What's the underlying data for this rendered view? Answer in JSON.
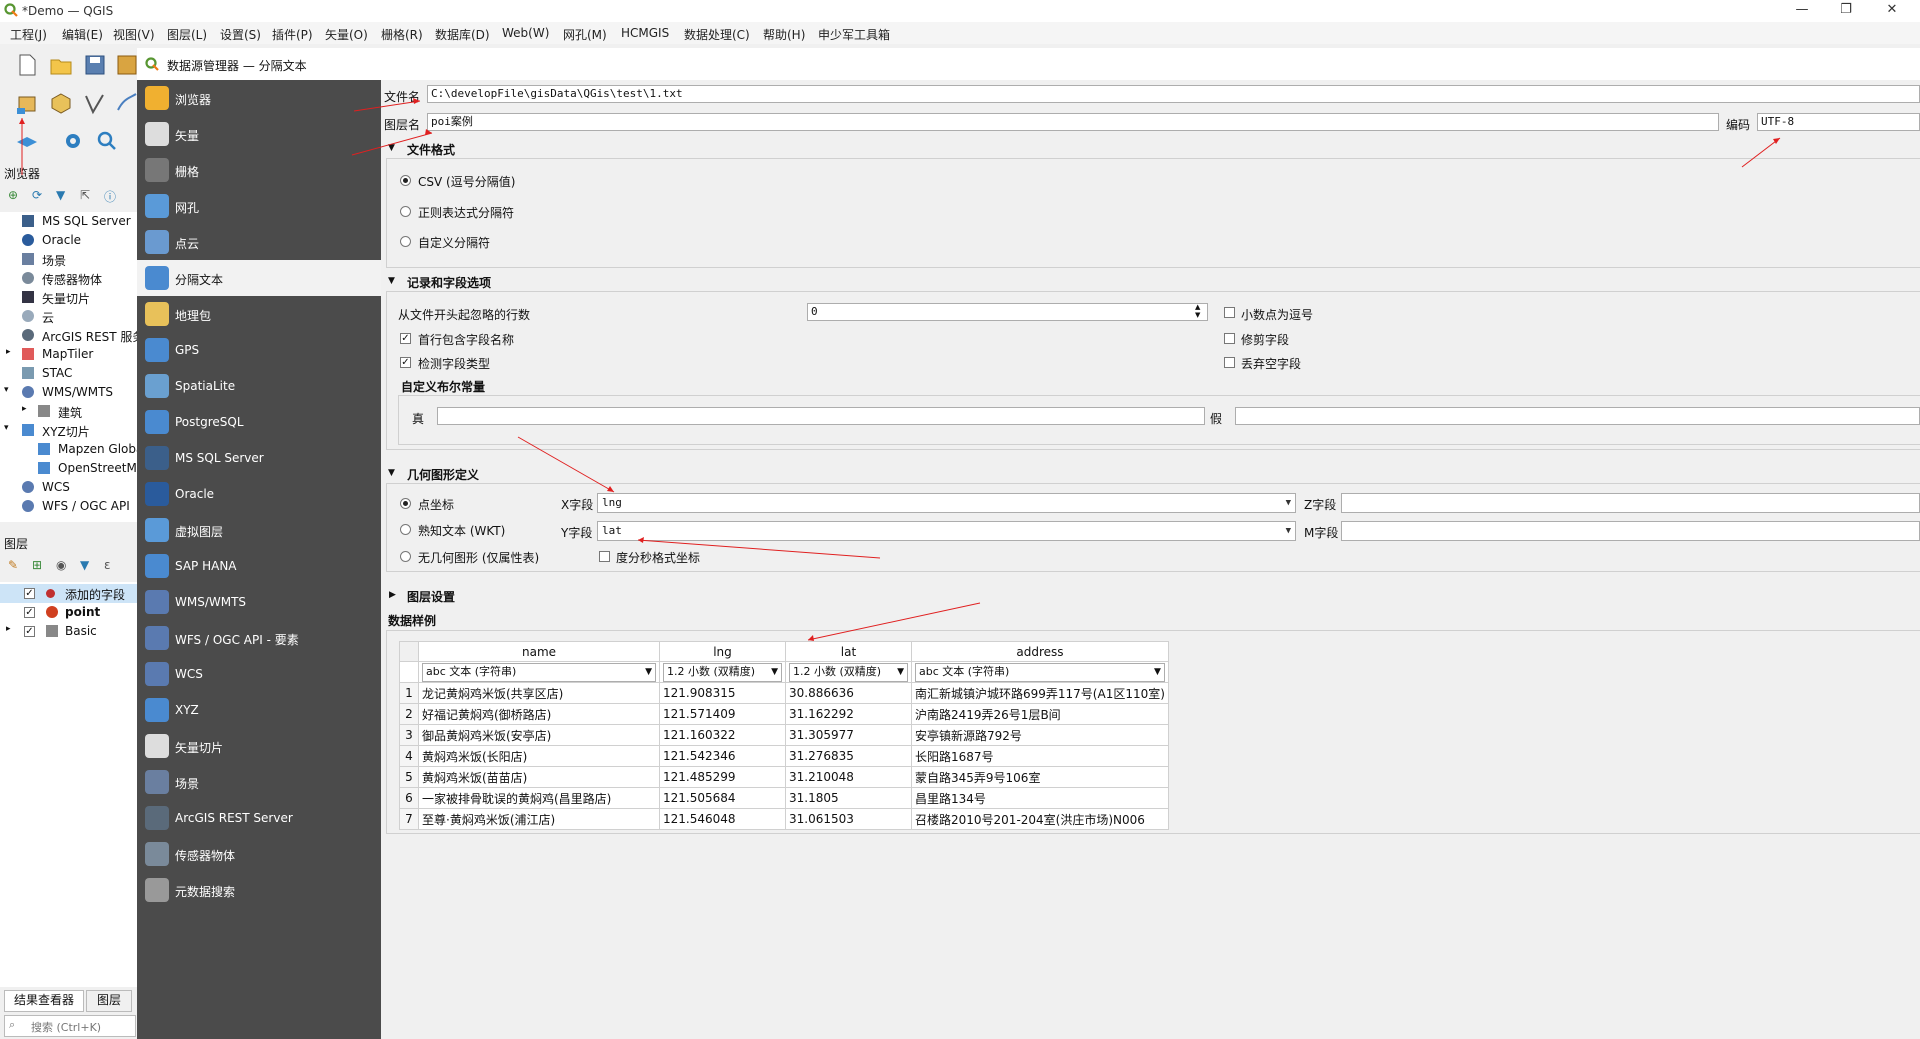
{
  "window": {
    "title": "*Demo — QGIS"
  },
  "menu": [
    "工程(J)",
    "编辑(E)",
    "视图(V)",
    "图层(L)",
    "设置(S)",
    "插件(P)",
    "矢量(O)",
    "栅格(R)",
    "数据库(D)",
    "Web(W)",
    "网孔(M)",
    "HCMGIS",
    "数据处理(C)",
    "帮助(H)",
    "申少军工具箱"
  ],
  "browser": {
    "title": "浏览器",
    "items": [
      "MS SQL Server",
      "Oracle",
      "场景",
      "传感器物体",
      "矢量切片",
      "云",
      "ArcGIS REST 服务",
      "MapTiler",
      "STAC",
      "WMS/WMTS",
      "建筑",
      "XYZ切片",
      "Mapzen Global",
      "OpenStreetMap",
      "WCS",
      "WFS / OGC API"
    ]
  },
  "layers": {
    "title": "图层",
    "items": [
      "添加的字段",
      "point",
      "Basic"
    ]
  },
  "bottom_tabs": [
    "结果查看器",
    "图层"
  ],
  "search": {
    "placeholder": "搜索 (Ctrl+K)"
  },
  "dsm": {
    "title": "数据源管理器 — 分隔文本",
    "side": [
      "浏览器",
      "矢量",
      "栅格",
      "网孔",
      "点云",
      "分隔文本",
      "地理包",
      "GPS",
      "SpatiaLite",
      "PostgreSQL",
      "MS SQL Server",
      "Oracle",
      "虚拟图层",
      "SAP HANA",
      "WMS/WMTS",
      "WFS / OGC API - 要素",
      "WCS",
      "XYZ",
      "矢量切片",
      "场景",
      "ArcGIS REST Server",
      "传感器物体",
      "元数据搜索"
    ]
  },
  "form": {
    "file_label": "文件名",
    "file_value": "C:\\developFile\\gisData\\QGis\\test\\1.txt",
    "layer_label": "图层名",
    "layer_value": "poi案例",
    "encoding_label": "编码",
    "encoding_value": "UTF-8",
    "fileformat_title": "文件格式",
    "fmt_csv": "CSV (逗号分隔值)",
    "fmt_regex": "正则表达式分隔符",
    "fmt_custom": "自定义分隔符",
    "records_title": "记录和字段选项",
    "skip_label": "从文件开头起忽略的行数",
    "skip_value": "0",
    "first_header": "首行包含字段名称",
    "detect_types": "检测字段类型",
    "decimal_comma": "小数点为逗号",
    "trim_fields": "修剪字段",
    "discard_empty": "丢弃空字段",
    "bool_title": "自定义布尔常量",
    "bool_true": "真",
    "bool_false": "假",
    "geom_title": "几何图形定义",
    "geom_point": "点坐标",
    "geom_wkt": "熟知文本 (WKT)",
    "geom_none": "无几何图形 (仅属性表)",
    "x_label": "X字段",
    "x_value": "lng",
    "y_label": "Y字段",
    "y_value": "lat",
    "z_label": "Z字段",
    "m_label": "M字段",
    "dms": "度分秒格式坐标",
    "layer_settings": "图层设置",
    "sample_title": "数据样例"
  },
  "table": {
    "columns": [
      "name",
      "lng",
      "lat",
      "address"
    ],
    "types": [
      "abc 文本 (字符串)",
      "1.2 小数 (双精度)",
      "1.2 小数 (双精度)",
      "abc 文本 (字符串)"
    ],
    "rows": [
      [
        "1",
        "龙记黄焖鸡米饭(共享区店)",
        "121.908315",
        "30.886636",
        "南汇新城镇沪城环路699弄117号(A1区110室)"
      ],
      [
        "2",
        "好福记黄焖鸡(御桥路店)",
        "121.571409",
        "31.162292",
        "沪南路2419弄26号1层B间"
      ],
      [
        "3",
        "御品黄焖鸡米饭(安亭店)",
        "121.160322",
        "31.305977",
        "安亭镇新源路792号"
      ],
      [
        "4",
        "黄焖鸡米饭(长阳店)",
        "121.542346",
        "31.276835",
        "长阳路1687号"
      ],
      [
        "5",
        "黄焖鸡米饭(苗苗店)",
        "121.485299",
        "31.210048",
        "蒙自路345弄9号106室"
      ],
      [
        "6",
        "一家被排骨耽误的黄焖鸡(昌里路店)",
        "121.505684",
        "31.1805",
        "昌里路134号"
      ],
      [
        "7",
        "至尊·黄焖鸡米饭(浦江店)",
        "121.546048",
        "31.061503",
        "召楼路2010号201-204室(洪庄市场)N006"
      ]
    ]
  }
}
